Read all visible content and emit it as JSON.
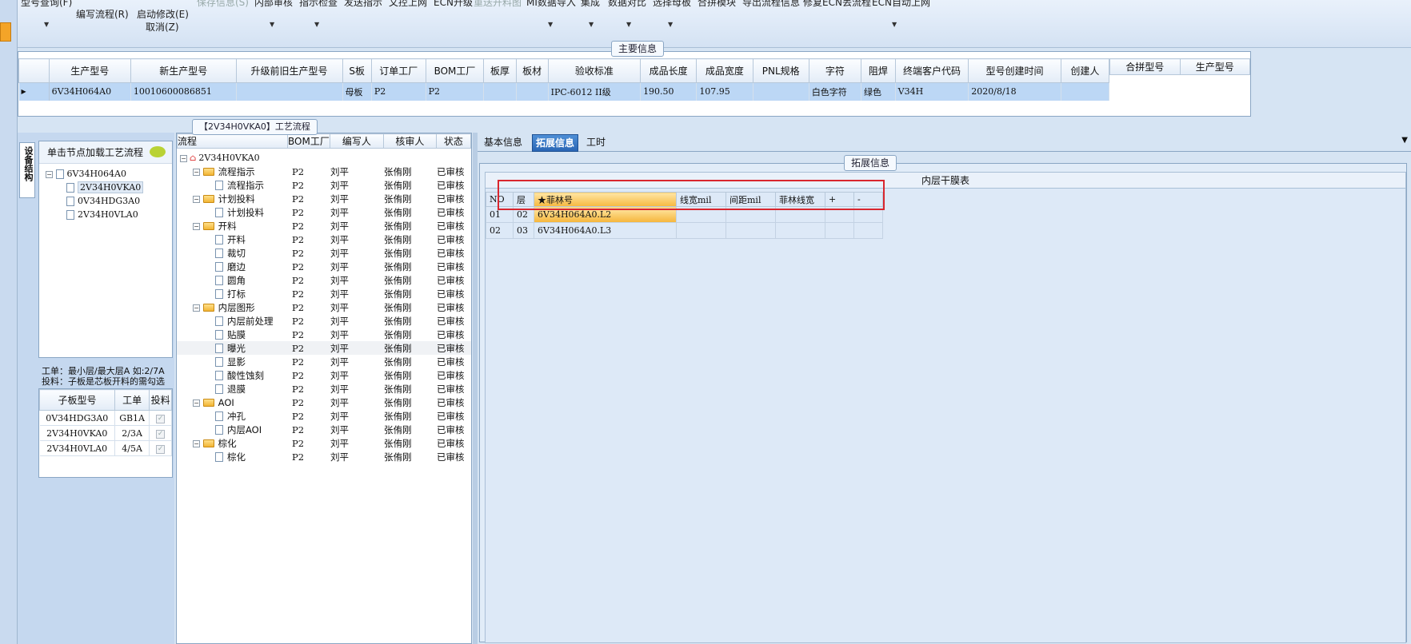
{
  "toolbar": {
    "row1": [
      "型号查询(F)",
      "编写流程(R)",
      "启动修改(E)",
      "保存信息(S)",
      "内部审核",
      "指示检查",
      "发送指示",
      "文控上网",
      "ECN升级",
      "重送开料图",
      "MI数据导入",
      "集成",
      "数据对比",
      "选择母板",
      "合拼模块",
      "导出流程信息",
      "修复ECN丢流程",
      "ECN自动上网"
    ],
    "cancel": "取消(Z)"
  },
  "main_info": {
    "title": "主要信息",
    "columns": [
      "生产型号",
      "新生产型号",
      "升级前旧生产型号",
      "S板",
      "订单工厂",
      "BOM工厂",
      "板厚",
      "板材",
      "验收标准",
      "成品长度",
      "成品宽度",
      "PNL规格",
      "字符",
      "阻焊",
      "终端客户代码",
      "型号创建时间",
      "创建人"
    ],
    "row": [
      "6V34H064A0",
      "10010600086851",
      "",
      "母板",
      "P2",
      "P2",
      "",
      "",
      "IPC-6012 II级",
      "190.50",
      "107.95",
      "",
      "白色字符",
      "绿色",
      "V34H",
      "2020/8/18",
      ""
    ],
    "right_cols": [
      "合拼型号",
      "生产型号"
    ]
  },
  "structure": {
    "vtab": "设备结构",
    "hint": "单击节点加载工艺流程",
    "root": "6V34H064A0",
    "children": [
      "2V34H0VKA0",
      "0V34HDG3A0",
      "2V34H0VLA0"
    ],
    "note1": "工单：最小层/最大层A 如:2/7A",
    "note2": "投料：子板是芯板开料的需勾选",
    "sub_cols": [
      "子板型号",
      "工单",
      "投料"
    ],
    "sub_rows": [
      [
        "0V34HDG3A0",
        "GB1A",
        "✓"
      ],
      [
        "2V34H0VKA0",
        "2/3A",
        "✓"
      ],
      [
        "2V34H0VLA0",
        "4/5A",
        "✓"
      ]
    ]
  },
  "flow": {
    "title": "【2V34H0VKA0】工艺流程",
    "cols": [
      "流程",
      "BOM工厂",
      "编写人",
      "核审人",
      "状态"
    ],
    "root": "2V34H0VKA0",
    "rows": [
      {
        "n": "流程指示",
        "lvl": 1
      },
      {
        "n": "流程指示",
        "lvl": 2
      },
      {
        "n": "计划投料",
        "lvl": 1
      },
      {
        "n": "计划投料",
        "lvl": 2
      },
      {
        "n": "开料",
        "lvl": 1
      },
      {
        "n": "开料",
        "lvl": 2
      },
      {
        "n": "裁切",
        "lvl": 2
      },
      {
        "n": "磨边",
        "lvl": 2
      },
      {
        "n": "圆角",
        "lvl": 2
      },
      {
        "n": "打标",
        "lvl": 2
      },
      {
        "n": "内层图形",
        "lvl": 1
      },
      {
        "n": "内层前处理",
        "lvl": 2
      },
      {
        "n": "贴膜",
        "lvl": 2
      },
      {
        "n": "曝光",
        "lvl": 2
      },
      {
        "n": "显影",
        "lvl": 2
      },
      {
        "n": "酸性蚀刻",
        "lvl": 2
      },
      {
        "n": "退膜",
        "lvl": 2
      },
      {
        "n": "AOI",
        "lvl": 1
      },
      {
        "n": "冲孔",
        "lvl": 2
      },
      {
        "n": "内层AOI",
        "lvl": 2
      },
      {
        "n": "棕化",
        "lvl": 1
      },
      {
        "n": "棕化",
        "lvl": 2
      }
    ],
    "factory": "P2",
    "writer": "刘平",
    "reviewer": "张侑刚",
    "status": "已审核"
  },
  "tabs": [
    "基本信息",
    "拓展信息",
    "工时"
  ],
  "ext": {
    "title": "拓展信息",
    "table_title": "内层干膜表",
    "cols": [
      "NO",
      "层",
      "★菲林号",
      "线宽mil",
      "间距mil",
      "菲林线宽",
      "+",
      "-"
    ],
    "rows": [
      [
        "01",
        "02",
        "6V34H064A0.L2"
      ],
      [
        "02",
        "03",
        "6V34H064A0.L3"
      ]
    ]
  },
  "colors": {
    "accent": "#f4a428",
    "highlight": "#ffe08a",
    "selection": "#bcd7f5",
    "red_box": "#d9262e"
  }
}
